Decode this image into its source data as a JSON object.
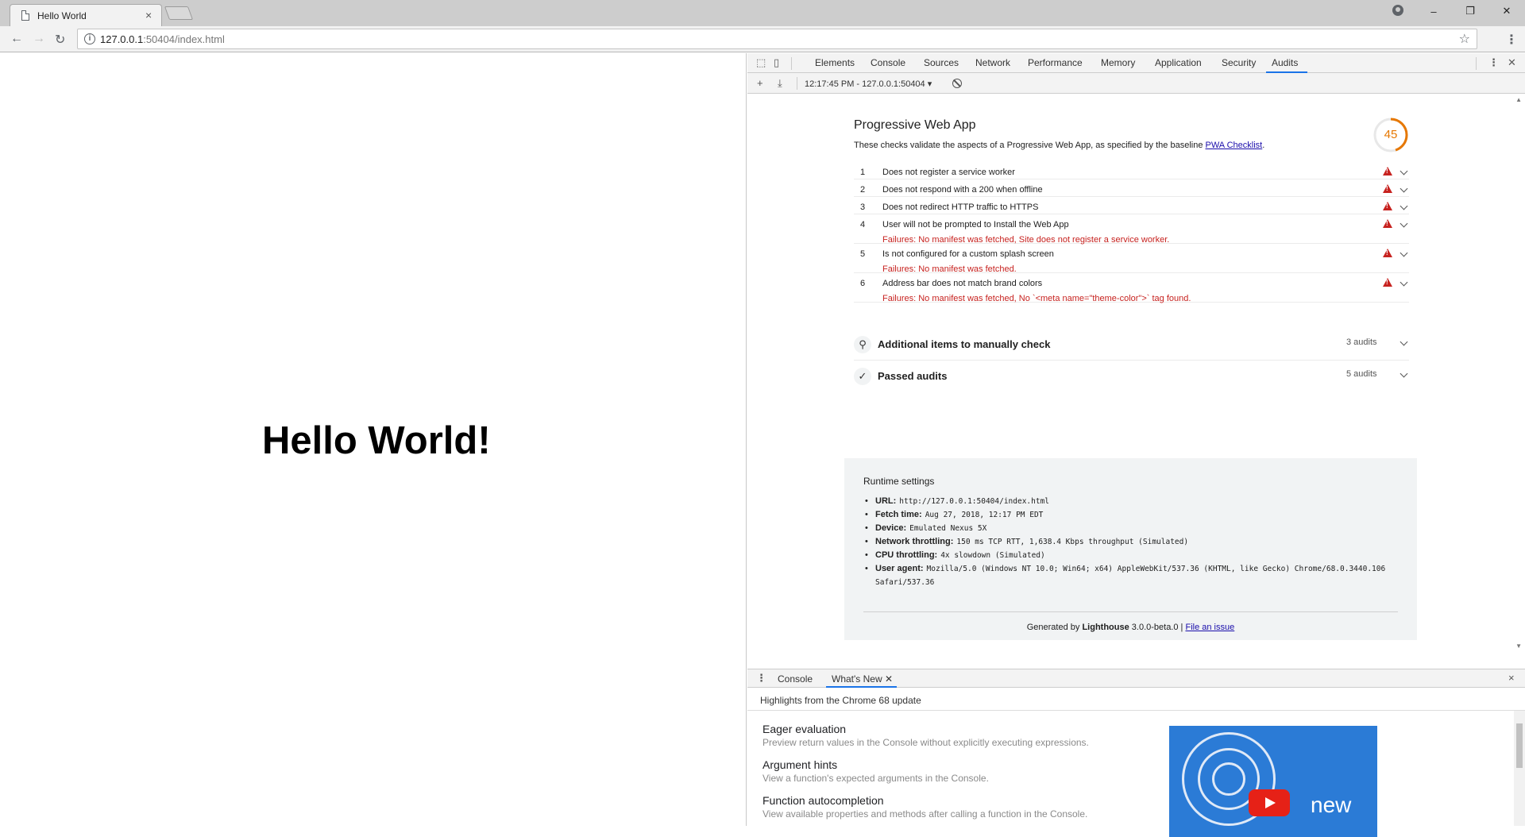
{
  "browser": {
    "tab_title": "Hello World",
    "tab_close": "×",
    "url_host": "127.0.0.1",
    "url_rest": ":50404/index.html",
    "window_buttons": [
      "–",
      "❐",
      "✕"
    ]
  },
  "page": {
    "heading": "Hello World!"
  },
  "devtools": {
    "tabs": [
      "Elements",
      "Console",
      "Sources",
      "Network",
      "Performance",
      "Memory",
      "Application",
      "Security",
      "Audits"
    ],
    "active_tab": "Audits",
    "audit_session": "12:17:45 PM - 127.0.0.1:50404 ▾",
    "pwa": {
      "title": "Progressive Web App",
      "description": "These checks validate the aspects of a Progressive Web App, as specified by the baseline ",
      "checklist_link": "PWA Checklist",
      "description_end": ".",
      "score": "45",
      "score_fraction": 0.45,
      "audits": [
        {
          "num": "1",
          "text": "Does not register a service worker",
          "failure": ""
        },
        {
          "num": "2",
          "text": "Does not respond with a 200 when offline",
          "failure": ""
        },
        {
          "num": "3",
          "text": "Does not redirect HTTP traffic to HTTPS",
          "failure": ""
        },
        {
          "num": "4",
          "text": "User will not be prompted to Install the Web App",
          "failure": "Failures: No manifest was fetched, Site does not register a service worker."
        },
        {
          "num": "5",
          "text": "Is not configured for a custom splash screen",
          "failure": "Failures: No manifest was fetched."
        },
        {
          "num": "6",
          "text": "Address bar does not match brand colors",
          "failure": "Failures: No manifest was fetched, No `<meta name=\"theme-color\">` tag found."
        }
      ],
      "manual": {
        "title": "Additional items to manually check",
        "count": "3 audits"
      },
      "passed": {
        "title": "Passed audits",
        "count": "5 audits"
      }
    },
    "runtime": {
      "title": "Runtime settings",
      "items": [
        {
          "label": "URL:",
          "value": "http://127.0.0.1:50404/index.html"
        },
        {
          "label": "Fetch time:",
          "value": "Aug 27, 2018, 12:17 PM EDT"
        },
        {
          "label": "Device:",
          "value": "Emulated Nexus 5X"
        },
        {
          "label": "Network throttling:",
          "value": "150 ms TCP RTT, 1,638.4 Kbps throughput (Simulated)"
        },
        {
          "label": "CPU throttling:",
          "value": "4x slowdown (Simulated)"
        },
        {
          "label": "User agent:",
          "value": "Mozilla/5.0 (Windows NT 10.0; Win64; x64) AppleWebKit/537.36 (KHTML, like Gecko) Chrome/68.0.3440.106 Safari/537.36"
        }
      ],
      "generated_prefix": "Generated by ",
      "generated_tool": "Lighthouse",
      "generated_version": " 3.0.0-beta.0 | ",
      "file_issue": "File an issue"
    },
    "drawer": {
      "tabs": [
        "Console",
        "What's New"
      ],
      "active_tab": "What's New",
      "close": "×",
      "highlights": "Highlights from the Chrome 68 update",
      "features": [
        {
          "title": "Eager evaluation",
          "desc": "Preview return values in the Console without explicitly executing expressions."
        },
        {
          "title": "Argument hints",
          "desc": "View a function's expected arguments in the Console."
        },
        {
          "title": "Function autocompletion",
          "desc": "View available properties and methods after calling a function in the Console."
        }
      ],
      "video_text": "new"
    }
  },
  "colors": {
    "accent": "#1a73e8",
    "fail": "#c7221f",
    "score": "#e67700"
  }
}
